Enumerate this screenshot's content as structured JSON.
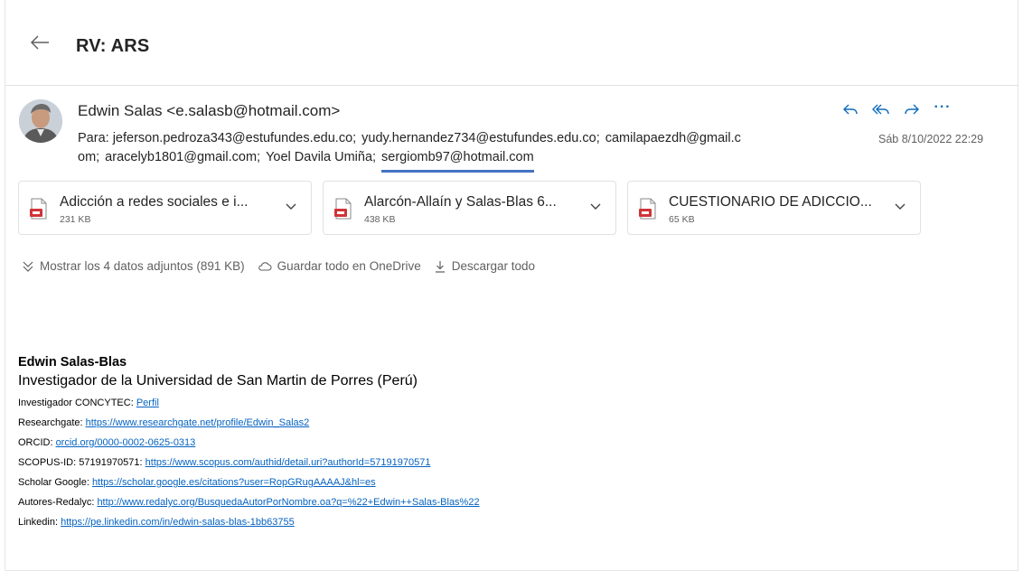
{
  "subject": "RV: ARS",
  "sender": {
    "display": "Edwin Salas <e.salasb@hotmail.com>"
  },
  "recipients_label": "Para:",
  "recipients": [
    "jeferson.pedroza343@estufundes.edu.co;",
    "yudy.hernandez734@estufundes.edu.co;",
    "camilapaezdh@gmail.c",
    "om;",
    "aracelyb1801@gmail.com;",
    "Yoel Davila Umiña;",
    "sergiomb97@hotmail.com"
  ],
  "date": "Sáb 8/10/2022 22:29",
  "actions": {
    "more": "···"
  },
  "icons": [
    "back-arrow-icon",
    "reply-icon",
    "reply-all-icon",
    "forward-icon",
    "more-icon",
    "pdf-file-icon",
    "chevron-down-icon",
    "expand-icon",
    "cloud-icon",
    "download-icon"
  ],
  "attachments": [
    {
      "name": "Adicción a redes sociales e i...",
      "size": "231 KB"
    },
    {
      "name": "Alarcón-Allaín y Salas-Blas 6...",
      "size": "438 KB"
    },
    {
      "name": "CUESTIONARIO DE ADICCIO...",
      "size": "65 KB"
    }
  ],
  "attachments_bar": {
    "show_all": "Mostrar los 4 datos adjuntos (891 KB)",
    "save_onedrive": "Guardar todo en OneDrive",
    "download_all": "Descargar todo"
  },
  "signature": {
    "name": "Edwin Salas-Blas",
    "title": "Investigador de la Universidad de San Martin de Porres (Perú)",
    "lines": [
      {
        "label": "Investigador CONCYTEC: ",
        "link": "Perfil"
      },
      {
        "label": "Researchgate: ",
        "link": "https://www.researchgate.net/profile/Edwin_Salas2"
      },
      {
        "label": "ORCID: ",
        "link": "orcid.org/0000-0002-0625-0313"
      },
      {
        "label": "SCOPUS-ID: 57191970571: ",
        "link": "https://www.scopus.com/authid/detail.uri?authorId=57191970571"
      },
      {
        "label": "Scholar Google: ",
        "link": "https://scholar.google.es/citations?user=RopGRugAAAAJ&hl=es"
      },
      {
        "label": "Autores-Redalyc: ",
        "link": "http://www.redalyc.org/BusquedaAutorPorNombre.oa?q=%22+Edwin++Salas-Blas%22"
      },
      {
        "label": "Linkedin: ",
        "link": "https://pe.linkedin.com/in/edwin-salas-blas-1bb63755"
      }
    ]
  },
  "colors": {
    "accent": "#0f6cbd",
    "link": "#0563c1",
    "selection_underline": "#4472c4",
    "pdf_red": "#d13438"
  }
}
